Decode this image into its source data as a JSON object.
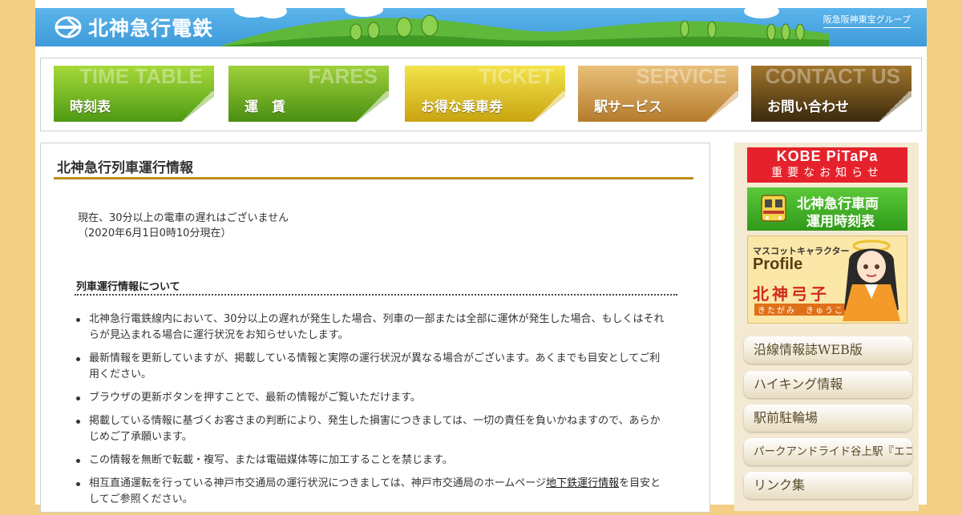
{
  "header": {
    "logo_text": "北神急行電鉄",
    "group_text": "阪急阪神東宝グループ"
  },
  "nav": [
    {
      "en": "TIME TABLE",
      "jp": "時刻表"
    },
    {
      "en": "FARES",
      "jp": "運　賃"
    },
    {
      "en": "TICKET",
      "jp": "お得な乗車券"
    },
    {
      "en": "SERVICE",
      "jp": "駅サービス"
    },
    {
      "en": "CONTACT US",
      "jp": "お問い合わせ"
    }
  ],
  "main": {
    "title": "北神急行列車運行情報",
    "status_line": "現在、30分以上の電車の遅れはございません",
    "status_time": "（2020年6月1日0時10分現在）",
    "subtitle": "列車運行情報について",
    "notes": [
      "北神急行電鉄線内において、30分以上の遅れが発生した場合、列車の一部または全部に運休が発生した場合、もしくはそれらが見込まれる場合に運行状況をお知らせいたします。",
      "最新情報を更新していますが、掲載している情報と実際の運行状況が異なる場合がございます。あくまでも目安としてご利用ください。",
      "ブラウザの更新ボタンを押すことで、最新の情報がご覧いただけます。",
      "掲載している情報に基づくお客さまの判断により、発生した損害につきましては、一切の責任を負いかねますので、あらかじめご了承願います。",
      "この情報を無断で転載・複写、または電磁媒体等に加工することを禁じます。"
    ],
    "last_note_before": "相互直通運転を行っている神戸市交通局の運行状況につきましては、神戸市交通局のホームページ",
    "last_note_link": "地下鉄運行情報",
    "last_note_after": "を目安としてご参照ください。"
  },
  "sidebar": {
    "pitapa_line1": "KOBE PiTaPa",
    "pitapa_line2": "重要なお知らせ",
    "train_line1": "北神急行車両",
    "train_line2": "運用時刻表",
    "mascot_caption": "マスコットキャラクター",
    "mascot_profile": "Profile",
    "mascot_name": "北神弓子",
    "mascot_reading": "きたがみ　きゅうこ",
    "links": [
      "沿線情報誌WEB版",
      "ハイキング情報",
      "駅前駐輪場",
      "パークアンドライド谷上駅『エコ駐車場』",
      "リンク集"
    ]
  },
  "colors": {
    "page_bg": "#f3cf85",
    "header_blue": "#3f9bda",
    "title_rule": "#c8950f",
    "pitapa_red": "#e5222b",
    "train_green": "#3aa821"
  }
}
